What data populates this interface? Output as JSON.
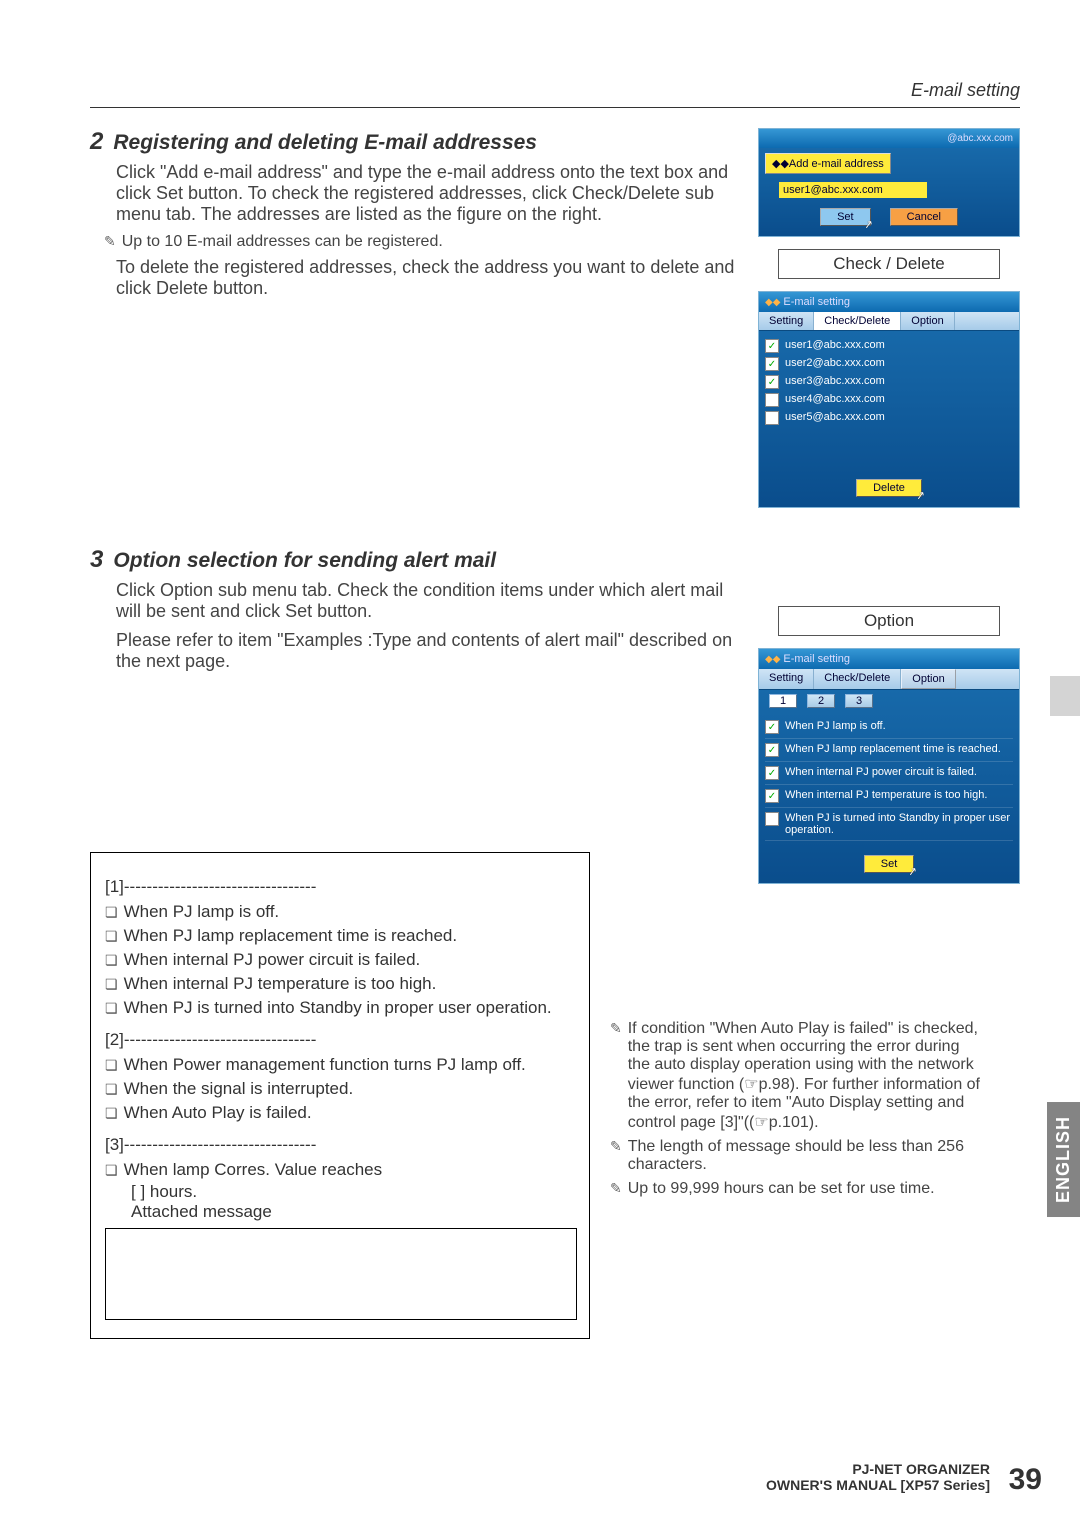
{
  "header_right": "E-mail setting",
  "section2": {
    "num": "2",
    "title": "Registering and deleting E-mail addresses",
    "para1": "Click \"Add e-mail address\" and type the e-mail address onto the text box and click Set button. To check the registered addresses, click Check/Delete sub menu tab. The addresses are listed as the figure on the right.",
    "note1": "Up to 10 E-mail addresses can be registered.",
    "para2": "To delete the registered addresses, check the address you want to delete and click Delete button."
  },
  "section3": {
    "num": "3",
    "title": "Option selection for sending alert mail",
    "para1": "Click Option sub menu tab. Check the condition items under which alert mail will be sent and click Set button.",
    "para2": "Please refer to item \"Examples :Type and contents of alert mail\" described on the next page."
  },
  "add_window": {
    "add_label": "Add e-mail address",
    "domain_hint": "@abc.xxx.com",
    "input_value": "user1@abc.xxx.com",
    "set_btn": "Set",
    "cancel_btn": "Cancel"
  },
  "cd_label": "Check / Delete",
  "cd_window": {
    "title": "E-mail setting",
    "tabs": {
      "setting": "Setting",
      "cd": "Check/Delete",
      "option": "Option"
    },
    "rows": [
      {
        "checked": true,
        "addr": "user1@abc.xxx.com"
      },
      {
        "checked": true,
        "addr": "user2@abc.xxx.com"
      },
      {
        "checked": true,
        "addr": "user3@abc.xxx.com"
      },
      {
        "checked": false,
        "addr": "user4@abc.xxx.com"
      },
      {
        "checked": false,
        "addr": "user5@abc.xxx.com"
      }
    ],
    "delete_btn": "Delete"
  },
  "opt_label": "Option",
  "opt_window": {
    "title": "E-mail setting",
    "tabs": {
      "setting": "Setting",
      "cd": "Check/Delete",
      "option": "Option"
    },
    "subtabs": [
      "1",
      "2",
      "3"
    ],
    "items": [
      {
        "checked": true,
        "text": "When PJ lamp is off."
      },
      {
        "checked": true,
        "text": "When PJ lamp replacement time is reached."
      },
      {
        "checked": true,
        "text": "When internal PJ power circuit is failed."
      },
      {
        "checked": true,
        "text": "When internal PJ temperature is too high."
      },
      {
        "checked": false,
        "text": "When PJ is turned into Standby in proper user operation."
      }
    ],
    "set_btn": "Set"
  },
  "checklist": {
    "g1_head": "[1]----------------------------------",
    "g1": [
      "When PJ lamp is off.",
      "When PJ lamp replacement time is reached.",
      "When internal PJ power circuit is failed.",
      "When internal PJ temperature is too high.",
      "When PJ is turned into Standby in proper user operation."
    ],
    "g2_head": "[2]----------------------------------",
    "g2": [
      "When Power management function turns PJ lamp off.",
      "When the signal is interrupted.",
      "When Auto Play is failed."
    ],
    "g3_head": "[3]----------------------------------",
    "g3_item": "When lamp Corres. Value reaches",
    "g3_hours": "[      ] hours.",
    "g3_attach": "Attached message"
  },
  "bottom_notes": {
    "n1": "If condition \"When Auto Play is failed\" is checked, the trap is sent when occurring the error during the auto display operation using with the network viewer function (☞p.98). For further information of the error, refer to item \"Auto Display setting and control page [3]\"((☞p.101).",
    "n2": "The length of message should be less than 256 characters.",
    "n3": "Up to 99,999 hours can be set for use time."
  },
  "footer": {
    "line1": "PJ-NET ORGANIZER",
    "line2": "OWNER'S MANUAL [XP57 Series]",
    "page": "39"
  },
  "edge_tab": "ENGLISH"
}
